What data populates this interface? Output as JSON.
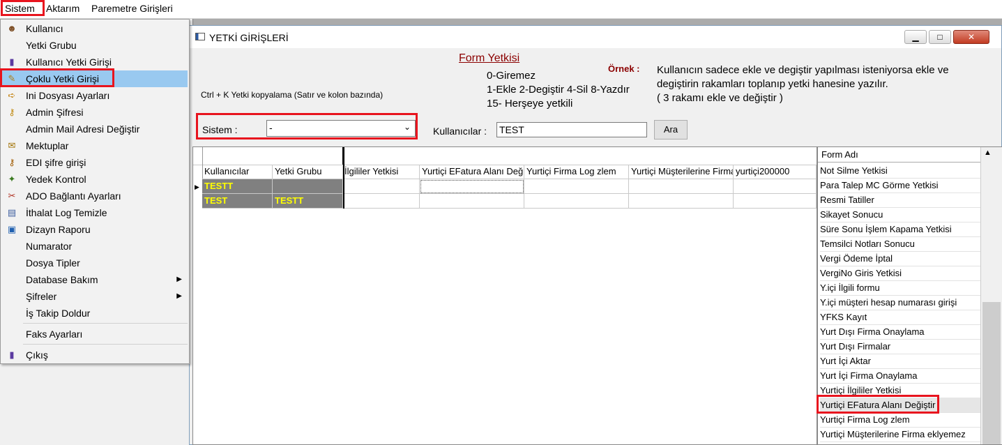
{
  "menubar": {
    "items": [
      "Sistem",
      "Aktarım",
      "Paremetre Girişleri"
    ]
  },
  "menu": {
    "items": [
      {
        "label": "Kullanıcı",
        "icon": "user-icon",
        "glyph": "☻",
        "color": "#7a4a20"
      },
      {
        "label": "Yetki Grubu",
        "icon": "",
        "glyph": "",
        "color": ""
      },
      {
        "label": "Kullanıcı Yetki Girişi",
        "icon": "key-door-icon",
        "glyph": "▮",
        "color": "#5b3aa0"
      },
      {
        "label": "Çoklu Yetki Girişi",
        "icon": "multi-key-icon",
        "glyph": "✎",
        "color": "#b07d10"
      },
      {
        "label": "Ini Dosyası  Ayarları",
        "icon": "ini-file-icon",
        "glyph": "➪",
        "color": "#c07a00"
      },
      {
        "label": "Admin Şifresi",
        "icon": "key-icon",
        "glyph": "⚷",
        "color": "#c08a10"
      },
      {
        "label": "Admin Mail Adresi Değiştir",
        "icon": "",
        "glyph": "",
        "color": ""
      },
      {
        "label": "Mektuplar",
        "icon": "letter-icon",
        "glyph": "✉",
        "color": "#a07000"
      },
      {
        "label": "EDI şifre girişi",
        "icon": "edi-key-icon",
        "glyph": "⚷",
        "color": "#a05a00"
      },
      {
        "label": "Yedek Kontrol",
        "icon": "backup-icon",
        "glyph": "✦",
        "color": "#3a7a20"
      },
      {
        "label": "ADO Bağlantı Ayarları",
        "icon": "connection-icon",
        "glyph": "✂",
        "color": "#b03020"
      },
      {
        "label": "İthalat Log Temizle",
        "icon": "log-clean-icon",
        "glyph": "▤",
        "color": "#4060a0"
      },
      {
        "label": "Dizayn Raporu",
        "icon": "report-icon",
        "glyph": "▣",
        "color": "#2060b0"
      },
      {
        "label": "Numarator",
        "icon": "",
        "glyph": "",
        "color": ""
      },
      {
        "label": "Dosya Tipler",
        "icon": "",
        "glyph": "",
        "color": ""
      },
      {
        "label": "Database Bakım",
        "icon": "",
        "glyph": "",
        "color": "",
        "submenu": true
      },
      {
        "label": "Şifreler",
        "icon": "",
        "glyph": "",
        "color": "",
        "submenu": true
      },
      {
        "label": "İş Takip Doldur",
        "icon": "",
        "glyph": "",
        "color": ""
      }
    ],
    "faks": "Faks Ayarları",
    "cikis": "Çıkış"
  },
  "window": {
    "title": "YETKİ GİRİŞLERİ",
    "form_yetkisi": "Form Yetkisi",
    "legend_line1": "0-Giremez",
    "legend_line2": "1-Ekle  2-Degiştir  4-Sil  8-Yazdır",
    "legend_line3": "15- Herşeye yetkili",
    "ornek_label": "Örnek :",
    "ornek_line1": "Kullanıcın sadece ekle ve degiştir yapılması isteniyorsa  ekle ve",
    "ornek_line2": "degiştirin rakamları toplanıp yetki hanesine yazılır.",
    "ornek_line3": " ( 3 rakamı ekle ve değiştir )",
    "ctrl_hint": "Ctrl + K Yetki kopyalama (Satır ve kolon bazında)",
    "sistem_label": "Sistem :",
    "sistem_value": "-",
    "kullanicilar_label": "Kullanıcılar :",
    "kullanicilar_value": "TEST",
    "ara_button": "Ara"
  },
  "grid": {
    "columns": [
      "Kullanıcılar",
      "Yetki Grubu",
      "İlgililer Yetkisi",
      "Yurtiçi EFatura Alanı Değiştir",
      "Yurtiçi Firma Log zlem",
      "Yurtiçi Müşterilerine Firma eklyemez",
      "yurtiçi200000"
    ],
    "rows": [
      {
        "user": "TESTT",
        "group": ""
      },
      {
        "user": "TEST",
        "group": "TESTT"
      }
    ]
  },
  "formlist": {
    "header": "Form Adı",
    "items": [
      "Not Silme Yetkisi",
      "Para Talep MC Görme Yetkisi",
      "Resmi Tatiller",
      "Sikayet Sonucu",
      "Süre Sonu İşlem Kapama Yetkisi",
      "Temsilci Notları Sonucu",
      "Vergi Ödeme İptal",
      "VergiNo Giris Yetkisi",
      "Y.içi İlgili formu",
      "Y.içi müşteri hesap numarası girişi",
      "YFKS Kayıt",
      "Yurt Dışı Firma Onaylama",
      "Yurt Dışı Firmalar",
      "Yurt İçi Aktar",
      "Yurt İçi Firma Onaylama",
      "Yurtiçi İlgililer Yetkisi",
      "Yurtiçi EFatura Alanı Değiştir",
      "Yurtiçi Firma Log zlem",
      "Yurtiçi Müşterilerine Firma eklyemez"
    ]
  },
  "colors": {
    "highlight_red": "#e8141e",
    "menu_selected": "#99c9f0",
    "grid_name_fill": "#808080",
    "grid_name_text": "#ffff00",
    "form_title": "#8b0000"
  }
}
